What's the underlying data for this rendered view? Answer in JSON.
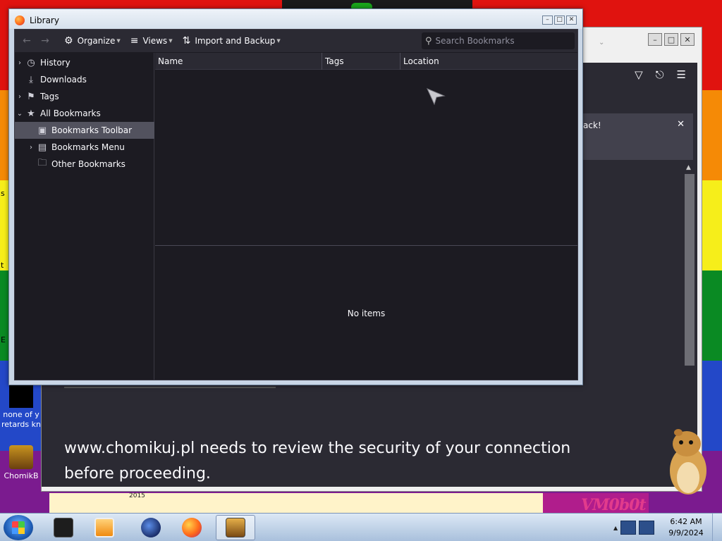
{
  "desktop": {
    "icon1_label": "none of y retards kn",
    "icon2_label": "ChomikB",
    "edge_labels": [
      "s",
      "t",
      "E"
    ],
    "wallpaper_text": "VM0b0t",
    "wallpaper_year": "2015"
  },
  "background_window": {
    "notification_text": "ack!",
    "notification_close": "✕",
    "message": "www.chomikuj.pl needs to review the security of your connection before proceeding."
  },
  "library": {
    "title": "Library",
    "title_buttons": [
      "–",
      "□",
      "✕"
    ],
    "toolbar": {
      "organize_label": "Organize",
      "views_label": "Views",
      "import_backup_label": "Import and Backup",
      "search_placeholder": "Search Bookmarks"
    },
    "tree": [
      {
        "label": "History",
        "icon": "clock-icon",
        "twisty": "›"
      },
      {
        "label": "Downloads",
        "icon": "download-icon",
        "twisty": ""
      },
      {
        "label": "Tags",
        "icon": "tag-icon",
        "twisty": "›"
      },
      {
        "label": "All Bookmarks",
        "icon": "star-icon",
        "twisty": "⌄"
      },
      {
        "label": "Bookmarks Toolbar",
        "icon": "toolbar-icon",
        "twisty": "",
        "selected": true
      },
      {
        "label": "Bookmarks Menu",
        "icon": "menu-icon",
        "twisty": "›"
      },
      {
        "label": "Other Bookmarks",
        "icon": "folder-icon",
        "twisty": ""
      }
    ],
    "columns": [
      "Name",
      "Tags",
      "Location"
    ],
    "details_text": "No items"
  },
  "taskbar": {
    "clock_time": "6:42 AM",
    "clock_date": "9/9/2024",
    "apps": [
      "terminal",
      "media-player",
      "firefox-nightly",
      "firefox",
      "sandbox"
    ],
    "active_app": "sandbox"
  }
}
